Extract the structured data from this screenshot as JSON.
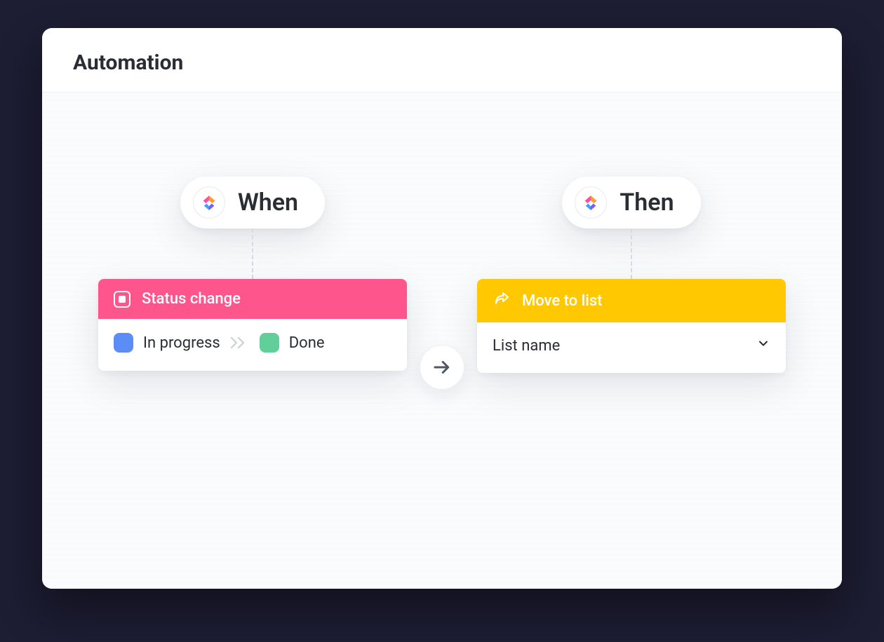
{
  "header": {
    "title": "Automation"
  },
  "when": {
    "label": "When",
    "trigger_label": "Status change",
    "from_status": "In progress",
    "to_status": "Done",
    "colors": {
      "header_bg": "#fd558c",
      "from_swatch": "#5c8df6",
      "to_swatch": "#62ce9a"
    }
  },
  "then": {
    "label": "Then",
    "action_label": "Move to list",
    "list_placeholder": "List name",
    "colors": {
      "header_bg": "#ffc800"
    }
  }
}
